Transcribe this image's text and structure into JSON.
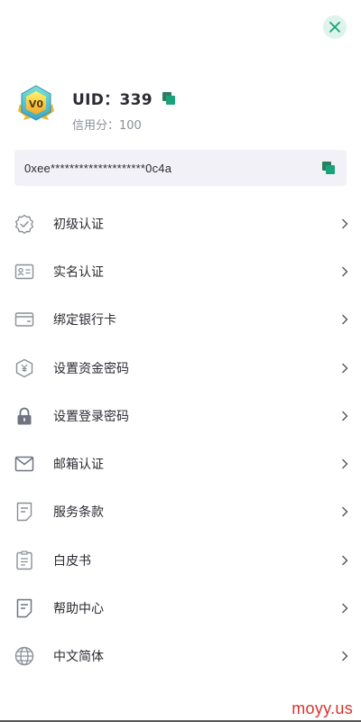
{
  "profile": {
    "uid_label": "UID：339",
    "credit_label": "信用分：100",
    "badge_text": "V0"
  },
  "address": {
    "value": "0xee********************0c4a"
  },
  "menu": {
    "items": [
      {
        "label": "初级认证",
        "icon": "verified-badge-icon"
      },
      {
        "label": "实名认证",
        "icon": "id-card-icon"
      },
      {
        "label": "绑定银行卡",
        "icon": "bank-card-icon"
      },
      {
        "label": "设置资金密码",
        "icon": "yuan-shield-icon"
      },
      {
        "label": "设置登录密码",
        "icon": "lock-icon"
      },
      {
        "label": "邮箱认证",
        "icon": "envelope-icon"
      },
      {
        "label": "服务条款",
        "icon": "document-icon"
      },
      {
        "label": "白皮书",
        "icon": "clipboard-icon"
      },
      {
        "label": "帮助中心",
        "icon": "help-document-icon"
      },
      {
        "label": "中文简体",
        "icon": "globe-icon"
      }
    ]
  },
  "colors": {
    "accent": "#1aa37a",
    "close_bg": "#ddf3ec",
    "address_bg": "#f2f1f7",
    "icon_gray": "#8a8f99",
    "watermark": "#d6342c"
  },
  "watermark": "moyy.us"
}
